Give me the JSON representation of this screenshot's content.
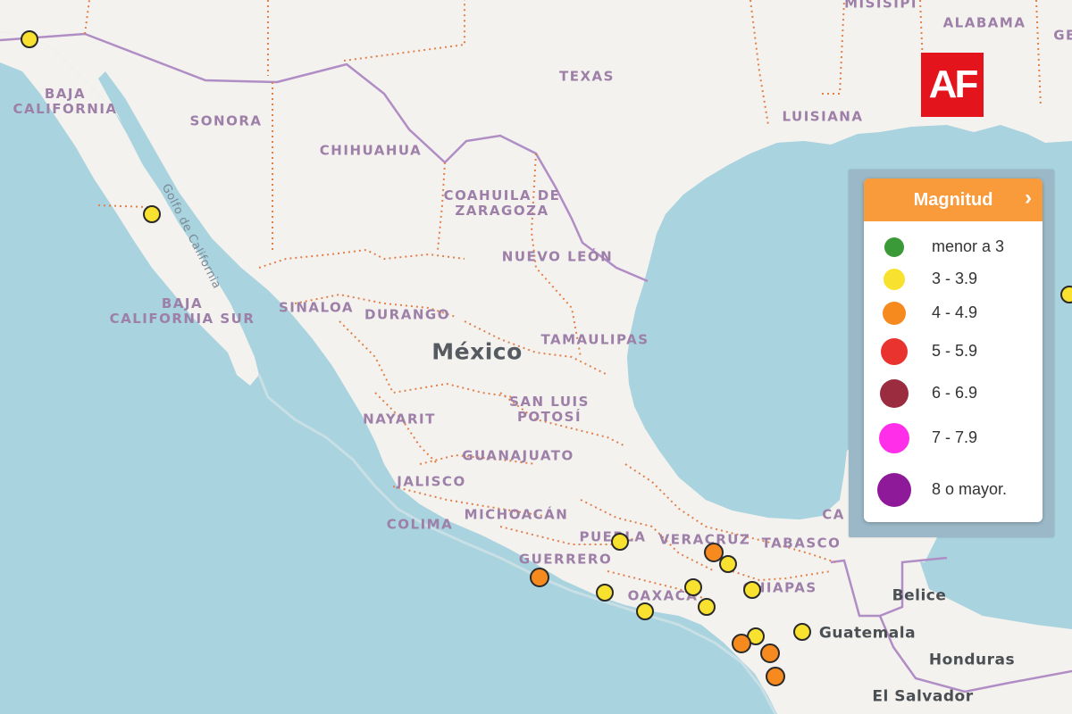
{
  "map": {
    "country_label": "México",
    "state_labels": [
      {
        "id": "baja-california",
        "text": "BAJA\nCALIFORNIA"
      },
      {
        "id": "sonora",
        "text": "SONORA"
      },
      {
        "id": "chihuahua",
        "text": "CHIHUAHUA"
      },
      {
        "id": "coahuila",
        "text": "COAHUILA DE\nZARAGOZA"
      },
      {
        "id": "nuevo-leon",
        "text": "NUEVO LEÓN"
      },
      {
        "id": "baja-california-sur",
        "text": "BAJA\nCALIFORNIA SUR"
      },
      {
        "id": "sinaloa",
        "text": "SINALOA"
      },
      {
        "id": "durango",
        "text": "DURANGO"
      },
      {
        "id": "tamaulipas",
        "text": "TAMAULIPAS"
      },
      {
        "id": "nayarit",
        "text": "NAYARIT"
      },
      {
        "id": "san-luis-potosi",
        "text": "SAN LUIS\nPOTOSÍ"
      },
      {
        "id": "guanajuato",
        "text": "GUANAJUATO"
      },
      {
        "id": "jalisco",
        "text": "JALISCO"
      },
      {
        "id": "michoacan",
        "text": "MICHOACÁN"
      },
      {
        "id": "colima",
        "text": "COLIMA"
      },
      {
        "id": "puebla",
        "text": "PUEBLA"
      },
      {
        "id": "veracruz",
        "text": "VERACRUZ"
      },
      {
        "id": "tabasco",
        "text": "TABASCO"
      },
      {
        "id": "guerrero",
        "text": "GUERRERO"
      },
      {
        "id": "oaxaca",
        "text": "OAXACA"
      },
      {
        "id": "chiapas",
        "text": "CHIAPAS"
      },
      {
        "id": "texas",
        "text": "TEXAS"
      },
      {
        "id": "luisiana",
        "text": "LUISIANA"
      },
      {
        "id": "alabama",
        "text": "ALABAMA"
      },
      {
        "id": "misisipi",
        "text": "MISISIPI"
      },
      {
        "id": "ge",
        "text": "GE"
      },
      {
        "id": "ca",
        "text": "CA"
      }
    ],
    "nation_labels": [
      {
        "id": "belice",
        "text": "Belice"
      },
      {
        "id": "guatemala",
        "text": "Guatemala"
      },
      {
        "id": "honduras",
        "text": "Honduras"
      },
      {
        "id": "el-salvador",
        "text": "El Salvador"
      }
    ],
    "water_labels": [
      {
        "id": "golfo-de-california",
        "text": "Golfo de California"
      }
    ]
  },
  "logo": {
    "text": "AF"
  },
  "legend": {
    "title": "Magnitud",
    "chevron": "›",
    "items": [
      {
        "label": "menor a 3",
        "color": "#3a9a37"
      },
      {
        "label": "3 - 3.9",
        "color": "#f8e12f"
      },
      {
        "label": "4 - 4.9",
        "color": "#f68a1f"
      },
      {
        "label": "5 - 5.9",
        "color": "#e8332f"
      },
      {
        "label": "6 - 6.9",
        "color": "#9b2c3f"
      },
      {
        "label": "7 - 7.9",
        "color": "#ff2ee8"
      },
      {
        "label": "8 o mayor.",
        "color": "#8e1a9a"
      }
    ]
  },
  "earthquakes": [
    {
      "id": "eq-1",
      "magnitude_class": "3 - 3.9",
      "color": "#f8e12f"
    },
    {
      "id": "eq-2",
      "magnitude_class": "3 - 3.9",
      "color": "#f8e12f"
    },
    {
      "id": "eq-3",
      "magnitude_class": "3 - 3.9",
      "color": "#f8e12f"
    },
    {
      "id": "eq-4",
      "magnitude_class": "4 - 4.9",
      "color": "#f68a1f"
    },
    {
      "id": "eq-5",
      "magnitude_class": "3 - 3.9",
      "color": "#f8e12f"
    },
    {
      "id": "eq-6",
      "magnitude_class": "4 - 4.9",
      "color": "#f68a1f"
    },
    {
      "id": "eq-7",
      "magnitude_class": "3 - 3.9",
      "color": "#f8e12f"
    },
    {
      "id": "eq-8",
      "magnitude_class": "3 - 3.9",
      "color": "#f8e12f"
    },
    {
      "id": "eq-9",
      "magnitude_class": "3 - 3.9",
      "color": "#f8e12f"
    },
    {
      "id": "eq-10",
      "magnitude_class": "3 - 3.9",
      "color": "#f8e12f"
    },
    {
      "id": "eq-11",
      "magnitude_class": "3 - 3.9",
      "color": "#f8e12f"
    },
    {
      "id": "eq-12",
      "magnitude_class": "3 - 3.9",
      "color": "#f8e12f"
    },
    {
      "id": "eq-13",
      "magnitude_class": "4 - 4.9",
      "color": "#f68a1f"
    },
    {
      "id": "eq-14",
      "magnitude_class": "4 - 4.9",
      "color": "#f68a1f"
    },
    {
      "id": "eq-15",
      "magnitude_class": "4 - 4.9",
      "color": "#f68a1f"
    },
    {
      "id": "eq-16",
      "magnitude_class": "3 - 3.9",
      "color": "#f8e12f"
    },
    {
      "id": "eq-17",
      "magnitude_class": "3 - 3.9",
      "color": "#f8e12f"
    }
  ]
}
